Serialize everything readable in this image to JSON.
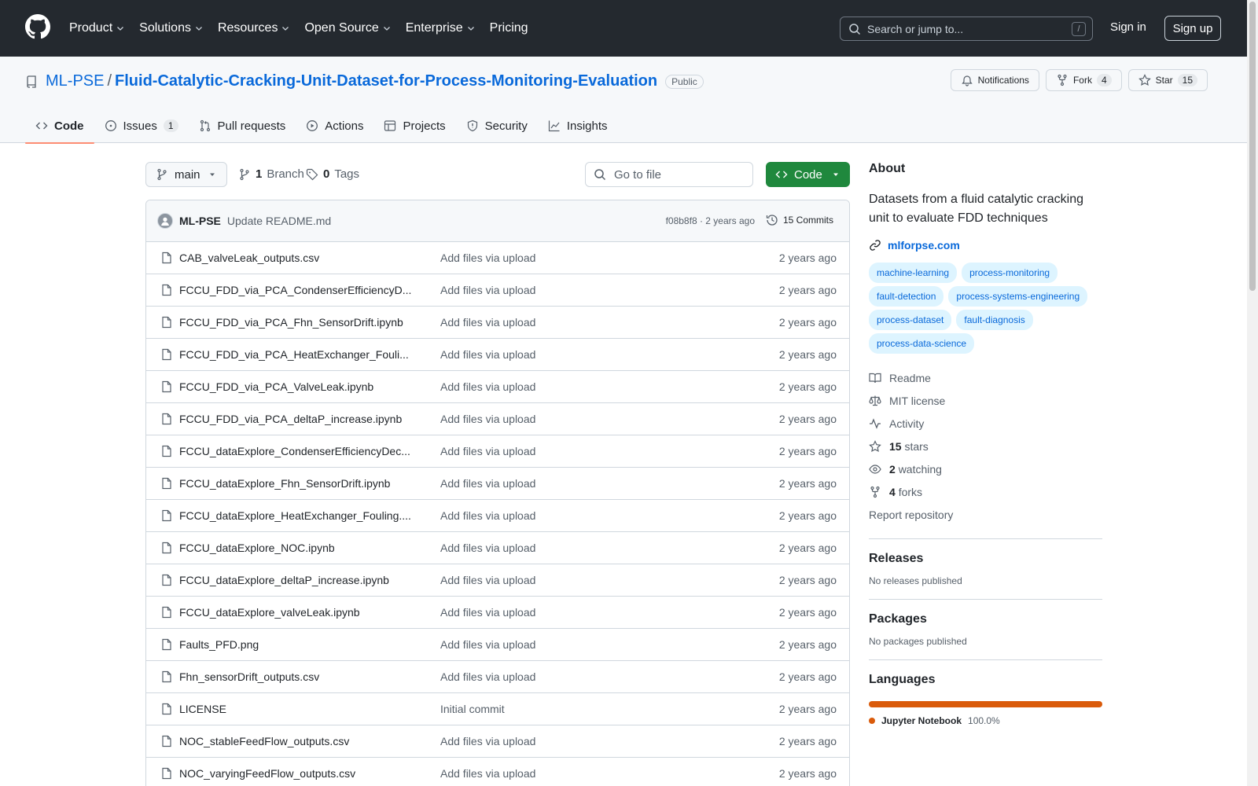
{
  "header": {
    "nav": [
      "Product",
      "Solutions",
      "Resources",
      "Open Source",
      "Enterprise",
      "Pricing"
    ],
    "search_placeholder": "Search or jump to...",
    "search_shortcut": "/",
    "signin": "Sign in",
    "signup": "Sign up"
  },
  "repo": {
    "owner": "ML-PSE",
    "separator": "/",
    "name": "Fluid-Catalytic-Cracking-Unit-Dataset-for-Process-Monitoring-Evaluation",
    "visibility": "Public",
    "notifications": "Notifications",
    "fork_label": "Fork",
    "fork_count": "4",
    "star_label": "Star",
    "star_count": "15"
  },
  "tabs": [
    {
      "label": "Code",
      "icon": "code-icon"
    },
    {
      "label": "Issues",
      "icon": "issue-icon",
      "count": "1"
    },
    {
      "label": "Pull requests",
      "icon": "pull-request-icon"
    },
    {
      "label": "Actions",
      "icon": "play-icon"
    },
    {
      "label": "Projects",
      "icon": "table-icon"
    },
    {
      "label": "Security",
      "icon": "shield-icon"
    },
    {
      "label": "Insights",
      "icon": "graph-icon"
    }
  ],
  "toolbar": {
    "branch": "main",
    "branches_count": "1",
    "branches_label": "Branch",
    "tags_count": "0",
    "tags_label": "Tags",
    "goto_placeholder": "Go to file",
    "code_button": "Code"
  },
  "commit": {
    "author": "ML-PSE",
    "message": "Update README.md",
    "meta": "f08b8f8 · 2 years ago",
    "commits_label": "15 Commits"
  },
  "files": [
    {
      "name": "CAB_valveLeak_outputs.csv",
      "message": "Add files via upload",
      "date": "2 years ago"
    },
    {
      "name": "FCCU_FDD_via_PCA_CondenserEfficiencyD...",
      "message": "Add files via upload",
      "date": "2 years ago"
    },
    {
      "name": "FCCU_FDD_via_PCA_Fhn_SensorDrift.ipynb",
      "message": "Add files via upload",
      "date": "2 years ago"
    },
    {
      "name": "FCCU_FDD_via_PCA_HeatExchanger_Fouli...",
      "message": "Add files via upload",
      "date": "2 years ago"
    },
    {
      "name": "FCCU_FDD_via_PCA_ValveLeak.ipynb",
      "message": "Add files via upload",
      "date": "2 years ago"
    },
    {
      "name": "FCCU_FDD_via_PCA_deltaP_increase.ipynb",
      "message": "Add files via upload",
      "date": "2 years ago"
    },
    {
      "name": "FCCU_dataExplore_CondenserEfficiencyDec...",
      "message": "Add files via upload",
      "date": "2 years ago"
    },
    {
      "name": "FCCU_dataExplore_Fhn_SensorDrift.ipynb",
      "message": "Add files via upload",
      "date": "2 years ago"
    },
    {
      "name": "FCCU_dataExplore_HeatExchanger_Fouling....",
      "message": "Add files via upload",
      "date": "2 years ago"
    },
    {
      "name": "FCCU_dataExplore_NOC.ipynb",
      "message": "Add files via upload",
      "date": "2 years ago"
    },
    {
      "name": "FCCU_dataExplore_deltaP_increase.ipynb",
      "message": "Add files via upload",
      "date": "2 years ago"
    },
    {
      "name": "FCCU_dataExplore_valveLeak.ipynb",
      "message": "Add files via upload",
      "date": "2 years ago"
    },
    {
      "name": "Faults_PFD.png",
      "message": "Add files via upload",
      "date": "2 years ago"
    },
    {
      "name": "Fhn_sensorDrift_outputs.csv",
      "message": "Add files via upload",
      "date": "2 years ago"
    },
    {
      "name": "LICENSE",
      "message": "Initial commit",
      "date": "2 years ago"
    },
    {
      "name": "NOC_stableFeedFlow_outputs.csv",
      "message": "Add files via upload",
      "date": "2 years ago"
    },
    {
      "name": "NOC_varyingFeedFlow_outputs.csv",
      "message": "Add files via upload",
      "date": "2 years ago"
    }
  ],
  "about": {
    "heading": "About",
    "description": "Datasets from a fluid catalytic cracking unit to evaluate FDD techniques",
    "homepage": "mlforpse.com",
    "topics": [
      "machine-learning",
      "process-monitoring",
      "fault-detection",
      "process-systems-engineering",
      "process-dataset",
      "fault-diagnosis",
      "process-data-science"
    ],
    "readme": "Readme",
    "license": "MIT license",
    "activity": "Activity",
    "stars_count": "15",
    "stars_label": "stars",
    "watching_count": "2",
    "watching_label": "watching",
    "forks_count": "4",
    "forks_label": "forks",
    "report": "Report repository"
  },
  "releases": {
    "heading": "Releases",
    "text": "No releases published"
  },
  "packages": {
    "heading": "Packages",
    "text": "No packages published"
  },
  "languages": {
    "heading": "Languages",
    "items": [
      {
        "name": "Jupyter Notebook",
        "percent": "100.0%",
        "color": "#da5b0b"
      }
    ]
  },
  "colors": {
    "header_bg": "#24292f",
    "link": "#0969da",
    "code_button": "#1f883d",
    "active_tab": "#fd8c73"
  }
}
